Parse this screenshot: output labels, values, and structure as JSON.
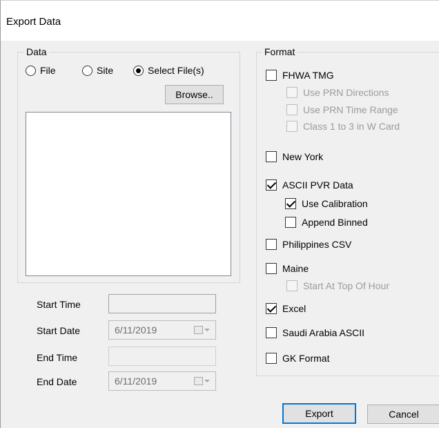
{
  "window": {
    "title": "Export Data"
  },
  "data_group": {
    "legend": "Data",
    "radios": [
      {
        "label": "File",
        "checked": false
      },
      {
        "label": "Site",
        "checked": false
      },
      {
        "label": "Select File(s)",
        "checked": true
      }
    ],
    "browse_label": "Browse.."
  },
  "time_fields": {
    "start_time_label": "Start Time",
    "start_date_label": "Start Date",
    "start_date_value": "6/11/2019",
    "end_time_label": "End Time",
    "end_date_label": "End Date",
    "end_date_value": "6/11/2019"
  },
  "format_group": {
    "legend": "Format",
    "fhwa_tmg": "FHWA TMG",
    "use_prn_directions": "Use PRN Directions",
    "use_prn_time_range": "Use PRN Time Range",
    "class_1_to_3": "Class 1 to 3 in W Card",
    "new_york": "New York",
    "ascii_pvr": "ASCII PVR Data",
    "use_calibration": "Use Calibration",
    "append_binned": "Append Binned",
    "philippines_csv": "Philippines CSV",
    "maine": "Maine",
    "start_top_of_hour": "Start At Top Of Hour",
    "excel": "Excel",
    "saudi_arabia": "Saudi Arabia ASCII",
    "gk_format": "GK Format"
  },
  "buttons": {
    "export": "Export",
    "cancel": "Cancel"
  }
}
